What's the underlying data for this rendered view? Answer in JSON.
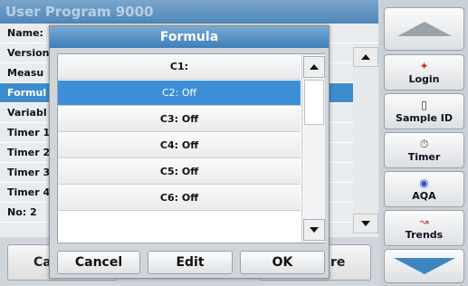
{
  "background": {
    "title": "User Program 9000",
    "rows": [
      "Name:",
      "Version",
      "Measu",
      "Formul",
      "Variabl",
      "Timer 1",
      "Timer 2",
      "Timer 3",
      "Timer 4",
      "No: 2"
    ],
    "highlighted_row": 3,
    "footer_left": "Ca",
    "footer_right": "re"
  },
  "sidebar": {
    "buttons": [
      {
        "label": "Login",
        "icon": "person-icon"
      },
      {
        "label": "Sample ID",
        "icon": "vial-icon"
      },
      {
        "label": "Timer",
        "icon": "timer-icon"
      },
      {
        "label": "AQA",
        "icon": "aqa-icon"
      },
      {
        "label": "Trends",
        "icon": "trends-icon"
      }
    ]
  },
  "dialog": {
    "title": "Formula",
    "options": [
      "C1:",
      "C2: Off",
      "C3: Off",
      "C4: Off",
      "C5: Off",
      "C6: Off"
    ],
    "selected_index": 1,
    "buttons": {
      "cancel": "Cancel",
      "edit": "Edit",
      "ok": "OK"
    }
  },
  "colors": {
    "accent": "#3c8fd6",
    "header": "#4f86b8"
  }
}
